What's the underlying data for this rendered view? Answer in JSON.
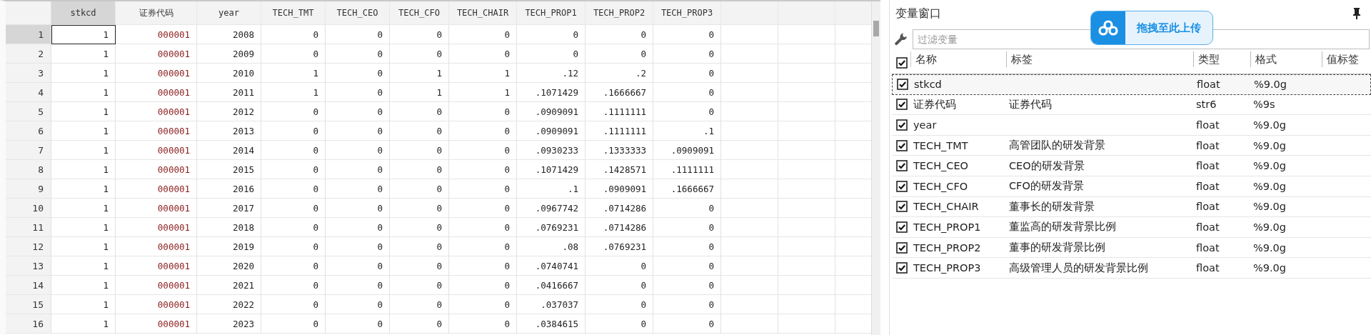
{
  "data_grid": {
    "columns": [
      {
        "label": "stkcd",
        "kind": "numeric",
        "selected": true
      },
      {
        "label": "证券代码",
        "kind": "string",
        "selected": false
      },
      {
        "label": "year",
        "kind": "numeric",
        "selected": false
      },
      {
        "label": "TECH_TMT",
        "kind": "numeric",
        "selected": false
      },
      {
        "label": "TECH_CEO",
        "kind": "numeric",
        "selected": false
      },
      {
        "label": "TECH_CFO",
        "kind": "numeric",
        "selected": false
      },
      {
        "label": "TECH_CHAIR",
        "kind": "numeric",
        "selected": false
      },
      {
        "label": "TECH_PROP1",
        "kind": "numeric",
        "selected": false
      },
      {
        "label": "TECH_PROP2",
        "kind": "numeric",
        "selected": false
      },
      {
        "label": "TECH_PROP3",
        "kind": "numeric",
        "selected": false
      }
    ],
    "rows": [
      {
        "number": "1",
        "selected": true,
        "cells": [
          "1",
          "000001",
          "2008",
          "0",
          "0",
          "0",
          "0",
          "0",
          "0",
          "0"
        ]
      },
      {
        "number": "2",
        "selected": false,
        "cells": [
          "1",
          "000001",
          "2009",
          "0",
          "0",
          "0",
          "0",
          "0",
          "0",
          "0"
        ]
      },
      {
        "number": "3",
        "selected": false,
        "cells": [
          "1",
          "000001",
          "2010",
          "1",
          "0",
          "1",
          "1",
          ".12",
          ".2",
          "0"
        ]
      },
      {
        "number": "4",
        "selected": false,
        "cells": [
          "1",
          "000001",
          "2011",
          "1",
          "0",
          "1",
          "1",
          ".1071429",
          ".1666667",
          "0"
        ]
      },
      {
        "number": "5",
        "selected": false,
        "cells": [
          "1",
          "000001",
          "2012",
          "0",
          "0",
          "0",
          "0",
          ".0909091",
          ".1111111",
          "0"
        ]
      },
      {
        "number": "6",
        "selected": false,
        "cells": [
          "1",
          "000001",
          "2013",
          "0",
          "0",
          "0",
          "0",
          ".0909091",
          ".1111111",
          ".1"
        ]
      },
      {
        "number": "7",
        "selected": false,
        "cells": [
          "1",
          "000001",
          "2014",
          "0",
          "0",
          "0",
          "0",
          ".0930233",
          ".1333333",
          ".0909091"
        ]
      },
      {
        "number": "8",
        "selected": false,
        "cells": [
          "1",
          "000001",
          "2015",
          "0",
          "0",
          "0",
          "0",
          ".1071429",
          ".1428571",
          ".1111111"
        ]
      },
      {
        "number": "9",
        "selected": false,
        "cells": [
          "1",
          "000001",
          "2016",
          "0",
          "0",
          "0",
          "0",
          ".1",
          ".0909091",
          ".1666667"
        ]
      },
      {
        "number": "10",
        "selected": false,
        "cells": [
          "1",
          "000001",
          "2017",
          "0",
          "0",
          "0",
          "0",
          ".0967742",
          ".0714286",
          "0"
        ]
      },
      {
        "number": "11",
        "selected": false,
        "cells": [
          "1",
          "000001",
          "2018",
          "0",
          "0",
          "0",
          "0",
          ".0769231",
          ".0714286",
          "0"
        ]
      },
      {
        "number": "12",
        "selected": false,
        "cells": [
          "1",
          "000001",
          "2019",
          "0",
          "0",
          "0",
          "0",
          ".08",
          ".0769231",
          "0"
        ]
      },
      {
        "number": "13",
        "selected": false,
        "cells": [
          "1",
          "000001",
          "2020",
          "0",
          "0",
          "0",
          "0",
          ".0740741",
          "0",
          "0"
        ]
      },
      {
        "number": "14",
        "selected": false,
        "cells": [
          "1",
          "000001",
          "2021",
          "0",
          "0",
          "0",
          "0",
          ".0416667",
          "0",
          "0"
        ]
      },
      {
        "number": "15",
        "selected": false,
        "cells": [
          "1",
          "000001",
          "2022",
          "0",
          "0",
          "0",
          "0",
          ".037037",
          "0",
          "0"
        ]
      },
      {
        "number": "16",
        "selected": false,
        "cells": [
          "1",
          "000001",
          "2023",
          "0",
          "0",
          "0",
          "0",
          ".0384615",
          "0",
          "0"
        ]
      }
    ]
  },
  "variables_window": {
    "title": "变量窗口",
    "filter": {
      "placeholder": "过滤变量"
    },
    "columns": [
      "名称",
      "标签",
      "类型",
      "格式",
      "值标签"
    ],
    "all_checked": true,
    "variables": [
      {
        "name": "stkcd",
        "type": "float",
        "format": "%9.0g",
        "checked": true,
        "selected": true
      },
      {
        "name": "证券代码",
        "label": "证券代码",
        "type": "str6",
        "format": "%9s",
        "checked": true,
        "selected": false
      },
      {
        "name": "year",
        "type": "float",
        "format": "%9.0g",
        "checked": true,
        "selected": false
      },
      {
        "name": "TECH_TMT",
        "label": "高管团队的研发背景",
        "type": "float",
        "format": "%9.0g",
        "checked": true,
        "selected": false
      },
      {
        "name": "TECH_CEO",
        "label": "CEO的研发背景",
        "type": "float",
        "format": "%9.0g",
        "checked": true,
        "selected": false
      },
      {
        "name": "TECH_CFO",
        "label": "CFO的研发背景",
        "type": "float",
        "format": "%9.0g",
        "checked": true,
        "selected": false
      },
      {
        "name": "TECH_CHAIR",
        "label": "董事长的研发背景",
        "type": "float",
        "format": "%9.0g",
        "checked": true,
        "selected": false
      },
      {
        "name": "TECH_PROP1",
        "label": "董监高的研发背景比例",
        "type": "float",
        "format": "%9.0g",
        "checked": true,
        "selected": false
      },
      {
        "name": "TECH_PROP2",
        "label": "董事的研发背景比例",
        "type": "float",
        "format": "%9.0g",
        "checked": true,
        "selected": false
      },
      {
        "name": "TECH_PROP3",
        "label": "高级管理人员的研发背景比例",
        "type": "float",
        "format": "%9.0g",
        "checked": true,
        "selected": false
      }
    ]
  },
  "upload_badge": {
    "label": "拖拽至此上传"
  }
}
